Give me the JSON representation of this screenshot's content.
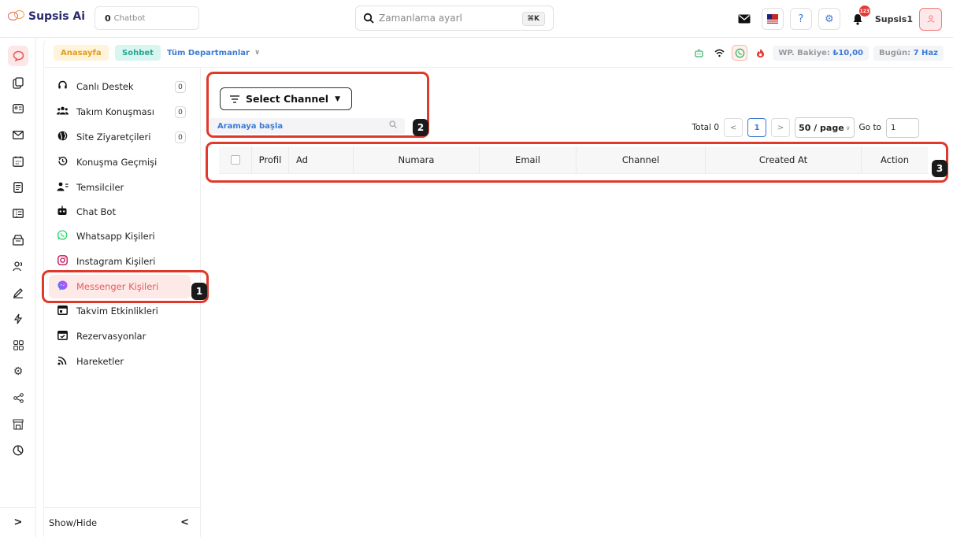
{
  "brand": {
    "name": "Supsis Ai",
    "accent": "#e85a5a"
  },
  "topbar": {
    "chatbot_count": "0",
    "chatbot_label": "Chatbot",
    "search_placeholder": "Zamanlama ayarl",
    "search_shortcut": "⌘K",
    "notification_count": "123",
    "username": "Supsis1"
  },
  "subbar": {
    "home": "Anasayfa",
    "chat": "Sohbet",
    "department": "Tüm Departmanlar",
    "wp_label": "WP. Bakiye:",
    "wp_value": "₺10,00",
    "today_label": "Bugün:",
    "today_value": "7 Haz"
  },
  "sidebar": {
    "items": [
      {
        "label": "Canlı Destek",
        "icon": "headset-icon",
        "count": "0"
      },
      {
        "label": "Takım Konuşması",
        "icon": "team-icon",
        "count": "0"
      },
      {
        "label": "Site Ziyaretçileri",
        "icon": "globe-icon",
        "count": "0"
      },
      {
        "label": "Konuşma Geçmişi",
        "icon": "history-icon"
      },
      {
        "label": "Temsilciler",
        "icon": "agents-icon"
      },
      {
        "label": "Chat Bot",
        "icon": "robot-icon"
      },
      {
        "label": "Whatsapp Kişileri",
        "icon": "whatsapp-icon"
      },
      {
        "label": "Instagram Kişileri",
        "icon": "instagram-icon"
      },
      {
        "label": "Messenger Kişileri",
        "icon": "messenger-icon",
        "active": true
      },
      {
        "label": "Takvim Etkinlikleri",
        "icon": "calendar-icon"
      },
      {
        "label": "Rezervasyonlar",
        "icon": "reservation-icon"
      },
      {
        "label": "Hareketler",
        "icon": "rss-icon"
      }
    ],
    "footer_label": "Show/Hide"
  },
  "main": {
    "select_channel": "Select Channel",
    "search_placeholder": "Aramaya başla",
    "pager": {
      "total": "Total 0",
      "current": "1",
      "page_size": "50 / page",
      "goto_label": "Go to",
      "goto_value": "1"
    },
    "columns": [
      "Profil",
      "Ad",
      "Numara",
      "Email",
      "Channel",
      "Created At",
      "Action"
    ]
  },
  "callouts": [
    "1",
    "2",
    "3"
  ]
}
